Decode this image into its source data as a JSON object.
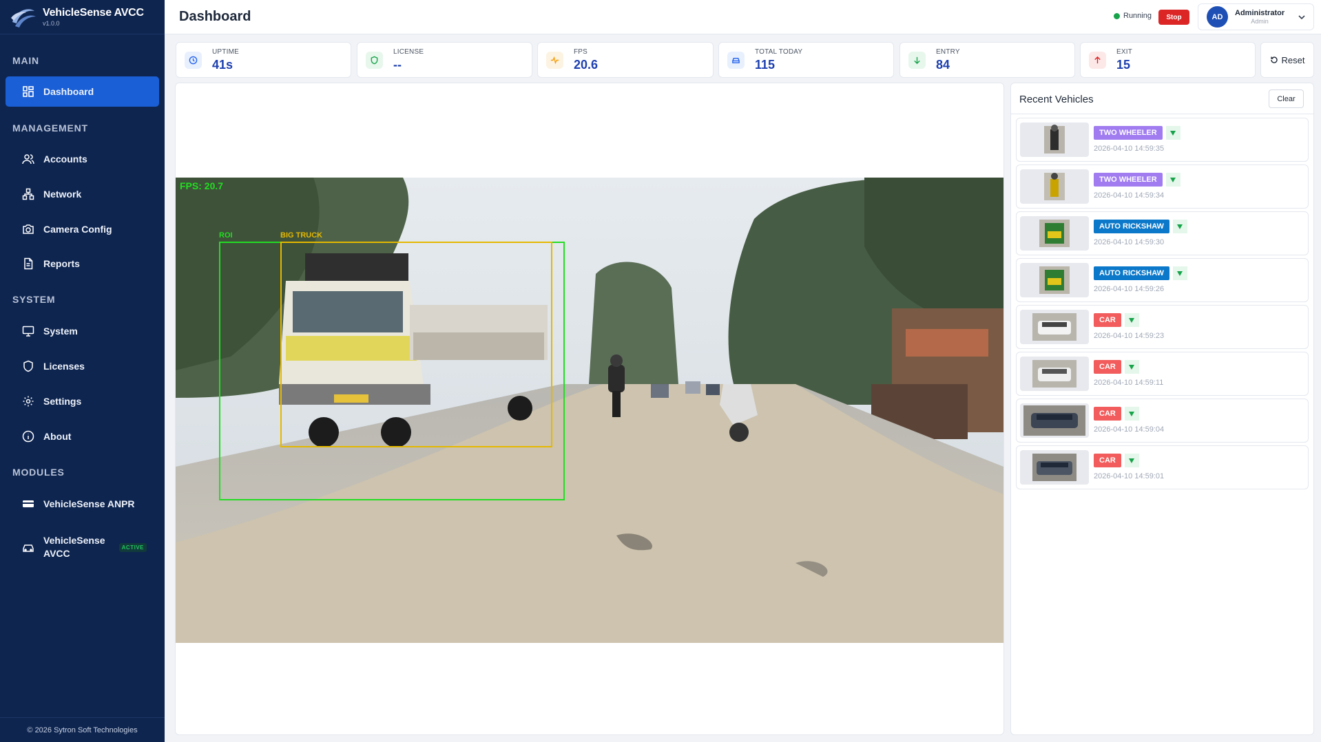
{
  "brand": {
    "name": "VehicleSense AVCC",
    "version": "v1.0.0"
  },
  "sidebar": {
    "sections": {
      "main": "MAIN",
      "management": "MANAGEMENT",
      "system": "SYSTEM",
      "modules": "MODULES"
    },
    "items": {
      "dashboard": "Dashboard",
      "accounts": "Accounts",
      "network": "Network",
      "camera_config": "Camera Config",
      "reports": "Reports",
      "system": "System",
      "licenses": "Licenses",
      "settings": "Settings",
      "about": "About",
      "anpr": "VehicleSense ANPR",
      "avcc": "VehicleSense AVCC",
      "avcc_badge": "ACTIVE"
    },
    "footer": "© 2026 Sytron Soft Technologies"
  },
  "header": {
    "title": "Dashboard",
    "status": "Running",
    "stop_label": "Stop",
    "user": {
      "initials": "AD",
      "name": "Administrator",
      "role": "Admin"
    }
  },
  "stats": {
    "uptime": {
      "label": "UPTIME",
      "value": "41s"
    },
    "license": {
      "label": "LICENSE",
      "value": "--"
    },
    "fps": {
      "label": "FPS",
      "value": "20.6"
    },
    "total_today": {
      "label": "TOTAL TODAY",
      "value": "115"
    },
    "entry": {
      "label": "ENTRY",
      "value": "84"
    },
    "exit": {
      "label": "EXIT",
      "value": "15"
    },
    "reset_label": "Reset"
  },
  "video": {
    "fps_overlay": "FPS: 20.7",
    "roi_label": "ROI",
    "detection_label": "BIG TRUCK"
  },
  "recent": {
    "title": "Recent Vehicles",
    "clear_label": "Clear",
    "items": [
      {
        "type": "TWO WHEELER",
        "color": "#a07cf0",
        "time": "2026-04-10 14:59:35"
      },
      {
        "type": "TWO WHEELER",
        "color": "#a07cf0",
        "time": "2026-04-10 14:59:34"
      },
      {
        "type": "AUTO RICKSHAW",
        "color": "#0b78c9",
        "time": "2026-04-10 14:59:30"
      },
      {
        "type": "AUTO RICKSHAW",
        "color": "#0b78c9",
        "time": "2026-04-10 14:59:26"
      },
      {
        "type": "CAR",
        "color": "#f25c5c",
        "time": "2026-04-10 14:59:23"
      },
      {
        "type": "CAR",
        "color": "#f25c5c",
        "time": "2026-04-10 14:59:11"
      },
      {
        "type": "CAR",
        "color": "#f25c5c",
        "time": "2026-04-10 14:59:04"
      },
      {
        "type": "CAR",
        "color": "#f25c5c",
        "time": "2026-04-10 14:59:01"
      }
    ]
  },
  "colors": {
    "sidebar_bg": "#0e2550",
    "accent": "#1a5fd6",
    "stop": "#dc2626",
    "running": "#16a34a",
    "stat_value": "#1e40af"
  }
}
